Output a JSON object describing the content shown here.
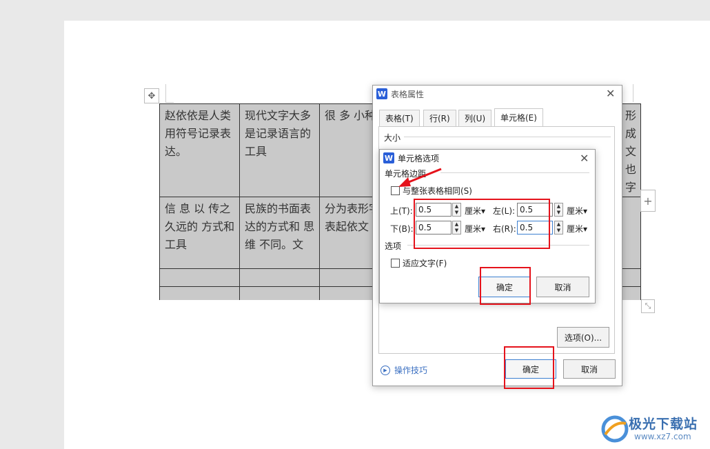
{
  "document": {
    "table_rows": [
      [
        "赵依依是人类用符号记录表达。",
        "现代文字大多是记录语言的工具",
        "很 多 小种，",
        "形成文也字"
      ],
      [
        "信 息 以 传之久远的  方式和工具",
        "民族的书面表达的方式和 思 维 不同。文",
        "分为表形字、表起依文",
        ""
      ],
      [
        "",
        "",
        "",
        ""
      ],
      [
        "",
        "",
        "",
        ""
      ]
    ],
    "move_handle_icon": "move-arrows-icon",
    "add_column_icon": "+",
    "resize_icon": "resize-corner-icon"
  },
  "table_properties_dialog": {
    "title": "表格属性",
    "tabs": [
      "表格(T)",
      "行(R)",
      "列(U)",
      "单元格(E)"
    ],
    "active_tab": "单元格(E)",
    "size_group": "大小",
    "tips_link": "操作技巧",
    "options_button": "选项(O)...",
    "ok_button": "确定",
    "cancel_button": "取消"
  },
  "cell_options_dialog": {
    "title": "单元格选项",
    "margin_group": "单元格边距",
    "same_as_table_label": "与整张表格相同(S)",
    "same_as_table_checked": false,
    "top_label": "上(T):",
    "top_value": "0.5",
    "bottom_label": "下(B):",
    "bottom_value": "0.5",
    "left_label": "左(L):",
    "left_value": "0.5",
    "right_label": "右(R):",
    "right_value": "0.5",
    "unit": "厘米▾",
    "options_group": "选项",
    "fit_text_label": "适应文字(F)",
    "fit_text_checked": false,
    "ok_button": "确定",
    "cancel_button": "取消"
  },
  "watermark": {
    "brand": "极光下载站",
    "url": "www.xz7.com"
  },
  "colors": {
    "highlight": "#e5121b",
    "table_fill": "#c9c9c9",
    "wps_blue": "#2a5fd8"
  }
}
